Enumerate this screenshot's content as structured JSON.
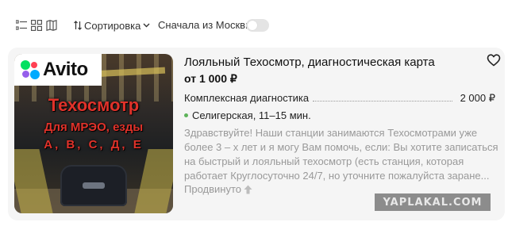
{
  "toolbar": {
    "view_icons": [
      "list-view-icon",
      "grid-view-icon",
      "map-view-icon"
    ],
    "sort_label": "Сортировка",
    "moscow_label": "Сначала из Москвы",
    "moscow_toggle_on": false
  },
  "listing": {
    "image": {
      "logo_text": "Avito",
      "overlay_line1": "Техосмотр",
      "overlay_line2": "Для МРЭО, езды",
      "overlay_line3": "А, В, С, Д, Е"
    },
    "title": "Лояльный Техосмотр, диагностическая карта",
    "price": "от 1 000 ₽",
    "service_name": "Комплексная диагностика",
    "service_price": "2 000 ₽",
    "location": "Селигерская, 11–15 мин.",
    "description_lines": [
      "Здравствуйте! Наши станции занимаются Техосмотрами уже",
      "более 3 – х лет и я могу Вам помочь, если: Вы хотите записаться",
      "на быстрый и лояльный техосмотр (есть станция, которая",
      "работает Круглосуточно 24/7, но уточните пожалуйста заране..."
    ],
    "promoted_label": "Продвинуто",
    "favorite_icon": "heart-icon"
  },
  "watermark": "YAPLAKAL.COM",
  "colors": {
    "card_bg": "#f5f5f5",
    "overlay_text": "#e0322a",
    "location_dot": "#5db35a",
    "muted_text": "#999999"
  }
}
